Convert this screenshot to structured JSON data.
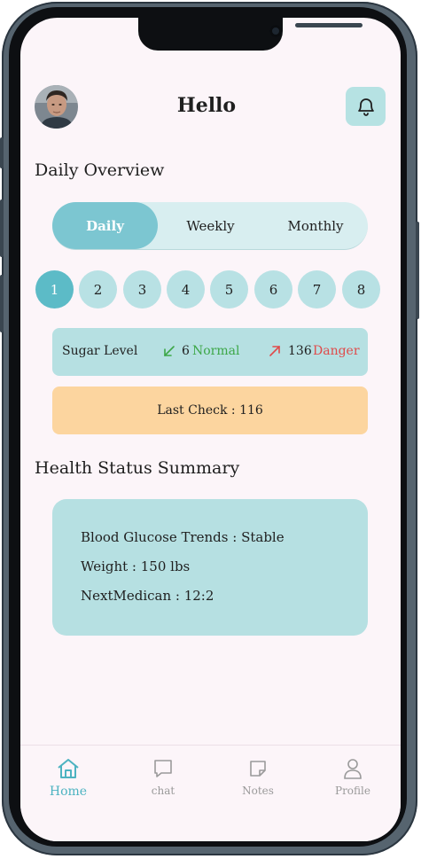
{
  "header": {
    "greeting": "Hello"
  },
  "overview": {
    "title": "Daily Overview",
    "tabs": [
      {
        "label": "Daily",
        "active": true
      },
      {
        "label": "Weekly",
        "active": false
      },
      {
        "label": "Monthly",
        "active": false
      }
    ],
    "days": [
      "1",
      "2",
      "3",
      "4",
      "5",
      "6",
      "7",
      "8"
    ],
    "selected_day": "1"
  },
  "sugar": {
    "label": "Sugar Level",
    "low_value": "6",
    "low_status": "Normal",
    "high_value": "136",
    "high_status": "Danger"
  },
  "last_check": {
    "text": "Last Check : 116"
  },
  "summary": {
    "title": "Health Status Summary",
    "lines": [
      "Blood Glucose Trends : Stable",
      "Weight : 150 lbs",
      "NextMedican : 12:2"
    ]
  },
  "nav": {
    "items": [
      {
        "label": "Home",
        "icon": "home-icon",
        "active": true
      },
      {
        "label": "chat",
        "icon": "chat-icon",
        "active": false
      },
      {
        "label": "Notes",
        "icon": "notes-icon",
        "active": false
      },
      {
        "label": "Profile",
        "icon": "profile-icon",
        "active": false
      }
    ]
  },
  "colors": {
    "accent": "#5cbbc7",
    "card": "#b6e0e2",
    "warning_card": "#fcd59f",
    "normal": "#3da748",
    "danger": "#e04a4a",
    "background": "#fcf5f9"
  }
}
